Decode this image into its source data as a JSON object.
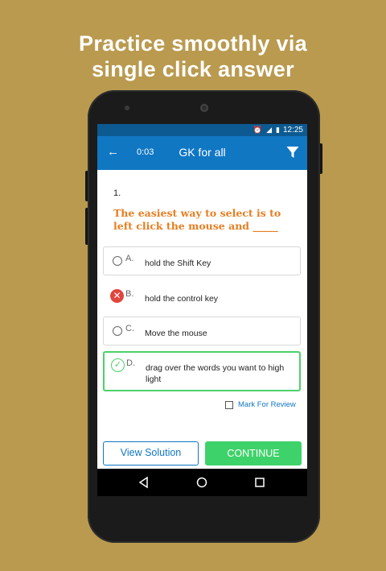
{
  "headline": {
    "line1": "Practice smoothly via",
    "line2": "single click answer"
  },
  "status_bar": {
    "time": "12:25",
    "icons": [
      "alarm-icon",
      "signal-icon",
      "battery-icon"
    ]
  },
  "app_bar": {
    "back_icon": "arrow-left-icon",
    "timer": "0:03",
    "title": "GK for all",
    "filter_icon": "filter-funnel-icon"
  },
  "question": {
    "number": "1.",
    "text": "The easiest way to select is to left click the mouse and _____"
  },
  "options": [
    {
      "letter": "A.",
      "text": "hold the Shift Key",
      "state": "unselected"
    },
    {
      "letter": "B.",
      "text": "hold the control key",
      "state": "wrong"
    },
    {
      "letter": "C.",
      "text": "Move the mouse",
      "state": "unselected"
    },
    {
      "letter": "D.",
      "text": "drag over the words you want to high light",
      "state": "correct"
    }
  ],
  "review": {
    "label": "Mark For Review",
    "checked": false
  },
  "buttons": {
    "view_solution": "View Solution",
    "continue": "CONTINUE"
  },
  "nav_bar": {
    "icons": [
      "back-triangle-icon",
      "home-circle-icon",
      "recents-square-icon"
    ]
  },
  "colors": {
    "background": "#b99a4f",
    "primary": "#1077c3",
    "status_bar": "#0c5a91",
    "question_text": "#e67e22",
    "correct": "#4cd16b",
    "wrong": "#e0453e",
    "continue_button": "#3ed26a"
  }
}
